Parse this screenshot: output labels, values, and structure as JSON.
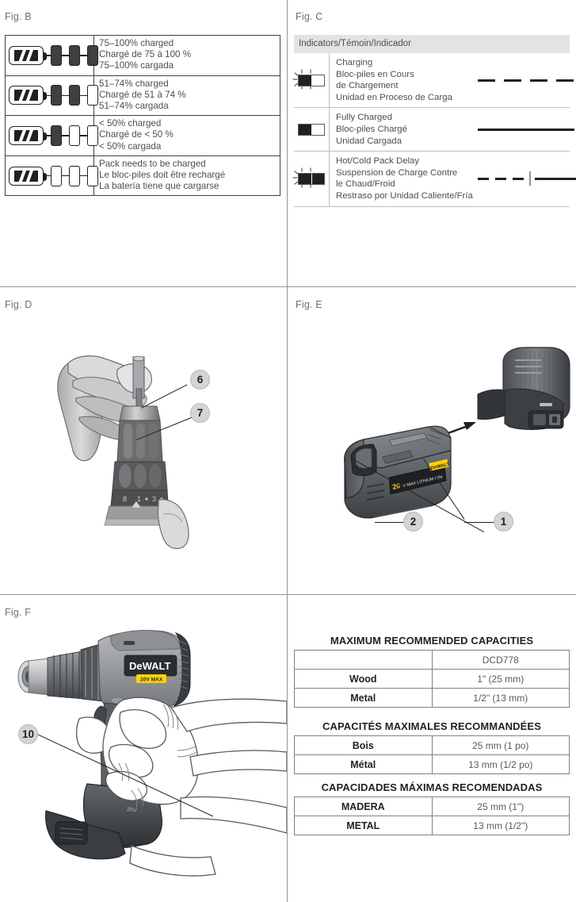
{
  "figures": {
    "b": {
      "label": "Fig. B"
    },
    "c": {
      "label": "Fig. C"
    },
    "d": {
      "label": "Fig. D"
    },
    "e": {
      "label": "Fig. E"
    },
    "f": {
      "label": "Fig. F"
    }
  },
  "fig_b": {
    "rows": [
      {
        "filled_cells": 3,
        "lines": [
          "75–100% charged",
          "Chargé de 75 à 100 %",
          "75–100% cargada"
        ]
      },
      {
        "filled_cells": 2,
        "lines": [
          "51–74% charged",
          "Chargé de 51 à 74 %",
          "51–74% cargada"
        ]
      },
      {
        "filled_cells": 1,
        "lines": [
          "< 50% charged",
          "Chargé de < 50 %",
          "< 50% cargada"
        ]
      },
      {
        "filled_cells": 0,
        "lines": [
          "Pack needs to be charged",
          "Le bloc-piles doit être rechargé",
          "La batería tiene que cargarse"
        ]
      }
    ]
  },
  "fig_c": {
    "header": "Indicators/Témoin/Indicador",
    "rows": [
      {
        "icon": "charging-light-icon",
        "lines": [
          "Charging",
          "Bloc-piles en Cours",
          "de Chargement",
          "Unidad en Proceso de Carga"
        ],
        "signal": "dashed",
        "glyph": "battery-icon"
      },
      {
        "icon": "fully-charged-light-icon",
        "lines": [
          "Fully Charged",
          "Bloc-piles Chargé",
          "Unidad Cargada"
        ],
        "signal": "solid",
        "glyph": "battery-icon"
      },
      {
        "icon": "hot-cold-delay-light-icon",
        "lines": [
          "Hot/Cold Pack Delay",
          "Suspension de Charge Contre",
          "le Chaud/Froid",
          "Restraso por Unidad Caliente/Fría"
        ],
        "signal": "dash-then-solid",
        "glyph": "thermometer-icon"
      }
    ]
  },
  "fig_d": {
    "callouts": [
      {
        "number": "6"
      },
      {
        "number": "7"
      }
    ]
  },
  "fig_e": {
    "callouts": [
      {
        "number": "2"
      },
      {
        "number": "1"
      }
    ],
    "battery_label": "20V MAX LITHIUM ION",
    "brand": "DeWALT"
  },
  "fig_f": {
    "callouts": [
      {
        "number": "10"
      }
    ],
    "brand": "DeWALT",
    "sub_brand": "20V MAX"
  },
  "capacity_tables": [
    {
      "title": "MAXIMUM RECOMMENDED CAPACITIES",
      "model_header": "DCD778",
      "has_header_row": true,
      "rows": [
        {
          "label": "Wood",
          "value": "1\" (25 mm)"
        },
        {
          "label": "Metal",
          "value": "1/2\" (13 mm)"
        }
      ]
    },
    {
      "title": "CAPACITÉS MAXIMALES RECOMMANDÉES",
      "has_header_row": false,
      "rows": [
        {
          "label": "Bois",
          "value": "25 mm (1 po)"
        },
        {
          "label": "Métal",
          "value": "13 mm (1/2 po)"
        }
      ]
    },
    {
      "title": "CAPACIDADES MÁXIMAS RECOMENDADAS",
      "has_header_row": false,
      "rows": [
        {
          "label": "MADERA",
          "value": "25 mm (1\")"
        },
        {
          "label": "METAL",
          "value": "13 mm (1/2\")"
        }
      ]
    }
  ],
  "colors": {
    "rule": "#939598",
    "text": "#4d4e50",
    "dark": "#231f20",
    "header_bg": "#e3e3e3",
    "callout_bg": "#d4d4d4"
  }
}
